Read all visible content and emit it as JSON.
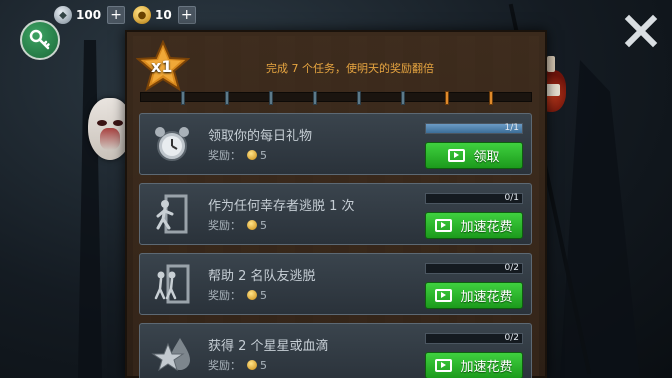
{
  "resources": {
    "silver_amount": "100",
    "gold_amount": "10",
    "add_symbol": "+"
  },
  "header": {
    "multiplier": "x1",
    "description": "完成 7 个任务，使明天的奖励翻倍",
    "milestones_total": 8,
    "milestones_done": 2
  },
  "reward_label": "奖励：",
  "tasks": [
    {
      "title": "领取你的每日礼物",
      "reward": "5",
      "progress": "1/1",
      "progress_fraction": 1.0,
      "action": "领取",
      "icon": "alarm-clock-icon"
    },
    {
      "title": "作为任何幸存者逃脱 1 次",
      "reward": "5",
      "progress": "0/1",
      "progress_fraction": 0.0,
      "action": "加速花费",
      "icon": "escape-door-icon"
    },
    {
      "title": "帮助 2 名队友逃脱",
      "reward": "5",
      "progress": "0/2",
      "progress_fraction": 0.0,
      "action": "加速花费",
      "icon": "team-escape-icon"
    },
    {
      "title": "获得 2 个星星或血滴",
      "reward": "5",
      "progress": "0/2",
      "progress_fraction": 0.0,
      "action": "加速花费",
      "icon": "star-blood-icon"
    }
  ],
  "colors": {
    "accent_orange": "#e6a540",
    "button_green": "#2fb82f",
    "progress_blue": "#4f82ad"
  }
}
